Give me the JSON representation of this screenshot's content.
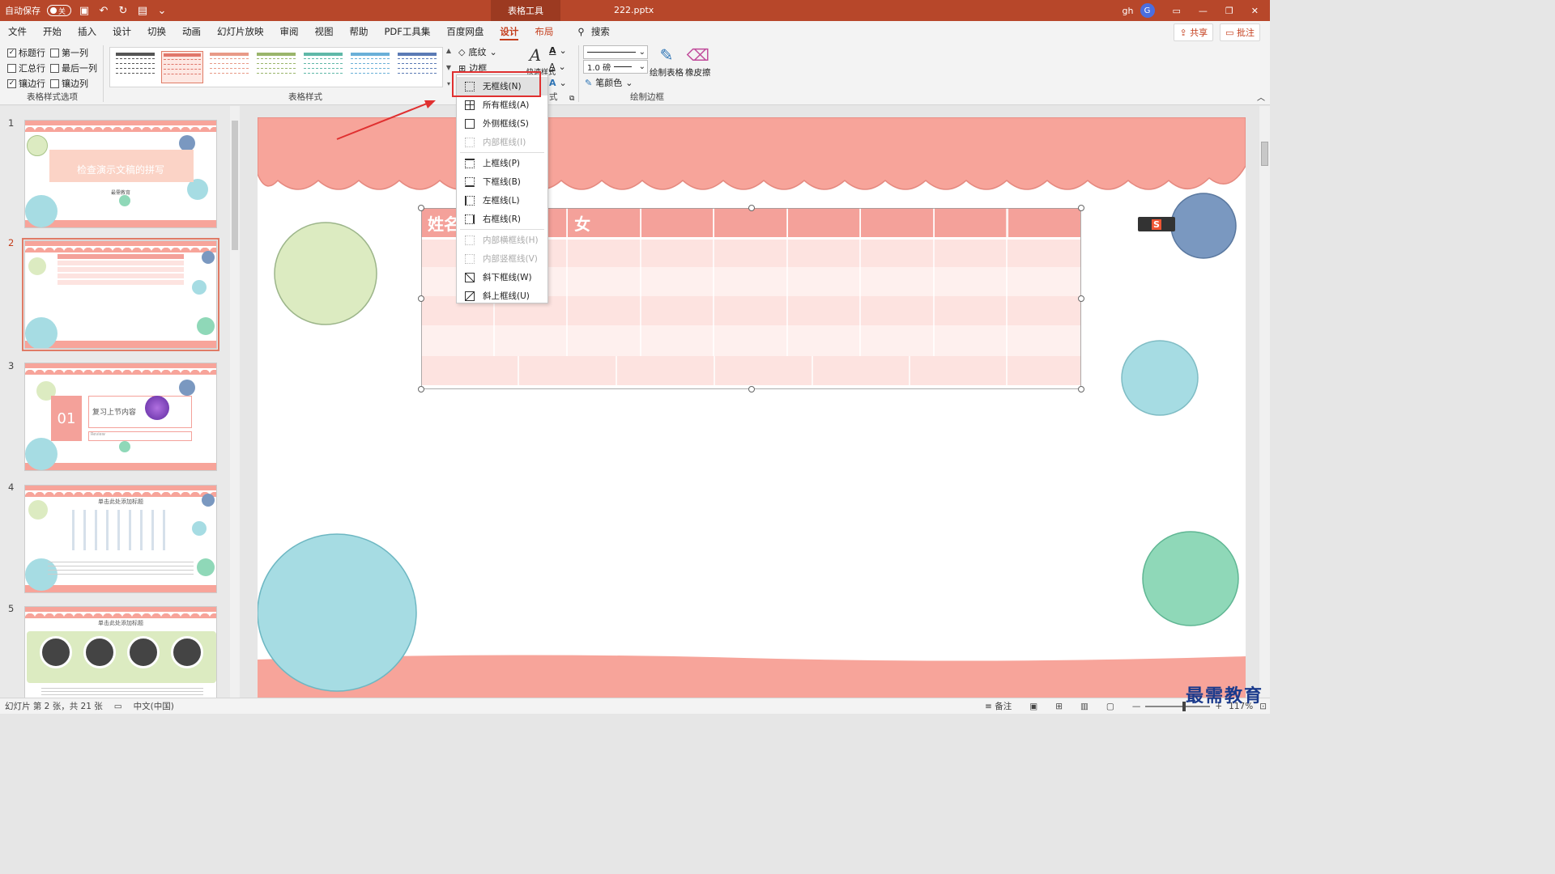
{
  "titlebar": {
    "autosave_label": "自动保存",
    "autosave_state": "关",
    "context_tool": "表格工具",
    "doc_title": "222.pptx",
    "user_initials": "gh",
    "avatar_letter": "G"
  },
  "menu": {
    "items": [
      "文件",
      "开始",
      "插入",
      "设计",
      "切换",
      "动画",
      "幻灯片放映",
      "审阅",
      "视图",
      "帮助",
      "PDF工具集",
      "百度网盘"
    ],
    "ctx_tabs": [
      "设计",
      "布局"
    ],
    "search": "搜索",
    "share": "共享",
    "comment": "批注"
  },
  "ribbon": {
    "options": {
      "header_row": "标题行",
      "first_column": "第一列",
      "total_row": "汇总行",
      "last_column": "最后一列",
      "banded_rows": "镶边行",
      "banded_columns": "镶边列",
      "group_label": "表格样式选项",
      "checked": {
        "header_row": true,
        "first_column": false,
        "total_row": false,
        "last_column": false,
        "banded_rows": true,
        "banded_columns": false
      }
    },
    "styles": {
      "group_label": "表格样式",
      "shading": "底纹",
      "borders": "边框",
      "thumb_colors": [
        "#555555",
        "#e0766a",
        "#e89a87",
        "#9ab56b",
        "#5fb8a8",
        "#6ab0d8",
        "#5b7bb5"
      ]
    },
    "wordart": {
      "quick_styles": "快速样式",
      "label_fragment": "式"
    },
    "draw": {
      "pen_weight": "1.0 磅",
      "pen_color": "笔颜色",
      "draw_table": "绘制表格",
      "eraser": "橡皮擦",
      "group_label": "绘制边框"
    }
  },
  "border_menu": {
    "items": [
      {
        "label": "无框线(N)",
        "disabled": false,
        "highlighted": true
      },
      {
        "label": "所有框线(A)",
        "disabled": false
      },
      {
        "label": "外侧框线(S)",
        "disabled": false
      },
      {
        "label": "内部框线(I)",
        "disabled": true
      },
      {
        "label": "上框线(P)",
        "disabled": false
      },
      {
        "label": "下框线(B)",
        "disabled": false
      },
      {
        "label": "左框线(L)",
        "disabled": false
      },
      {
        "label": "右框线(R)",
        "disabled": false
      },
      {
        "label": "内部横框线(H)",
        "disabled": true
      },
      {
        "label": "内部竖框线(V)",
        "disabled": true
      },
      {
        "label": "斜下框线(W)",
        "disabled": false
      },
      {
        "label": "斜上框线(U)",
        "disabled": false
      }
    ]
  },
  "thumbnails": [
    {
      "num": "1",
      "title": "检查演示文稿的拼写",
      "subtitle": "最需教育"
    },
    {
      "num": "2"
    },
    {
      "num": "3",
      "badge": "01",
      "title": "复习上节内容",
      "sub": "Review"
    },
    {
      "num": "4",
      "title": "单击此处添加标题"
    },
    {
      "num": "5",
      "title": "单击此处添加标题"
    }
  ],
  "slide": {
    "table_header": [
      "姓名",
      "",
      "女",
      "",
      "",
      "",
      "",
      "",
      ""
    ]
  },
  "statusbar": {
    "slide_info": "幻灯片 第 2 张，共 21 张",
    "language": "中文(中国)",
    "notes": "备注",
    "zoom": "117%"
  },
  "watermark": "最需教育",
  "colors": {
    "accent": "#b7472a",
    "slide_pink": "#f7a49a",
    "header_row": "#f4a19a",
    "band_light": "#fde3e0",
    "band_lighter": "#fef0ee",
    "green_circle": "#dcebc1",
    "blue_circle": "#7a98c0",
    "teal_circle": "#a6dce3",
    "mint_circle": "#8fd8b8"
  }
}
